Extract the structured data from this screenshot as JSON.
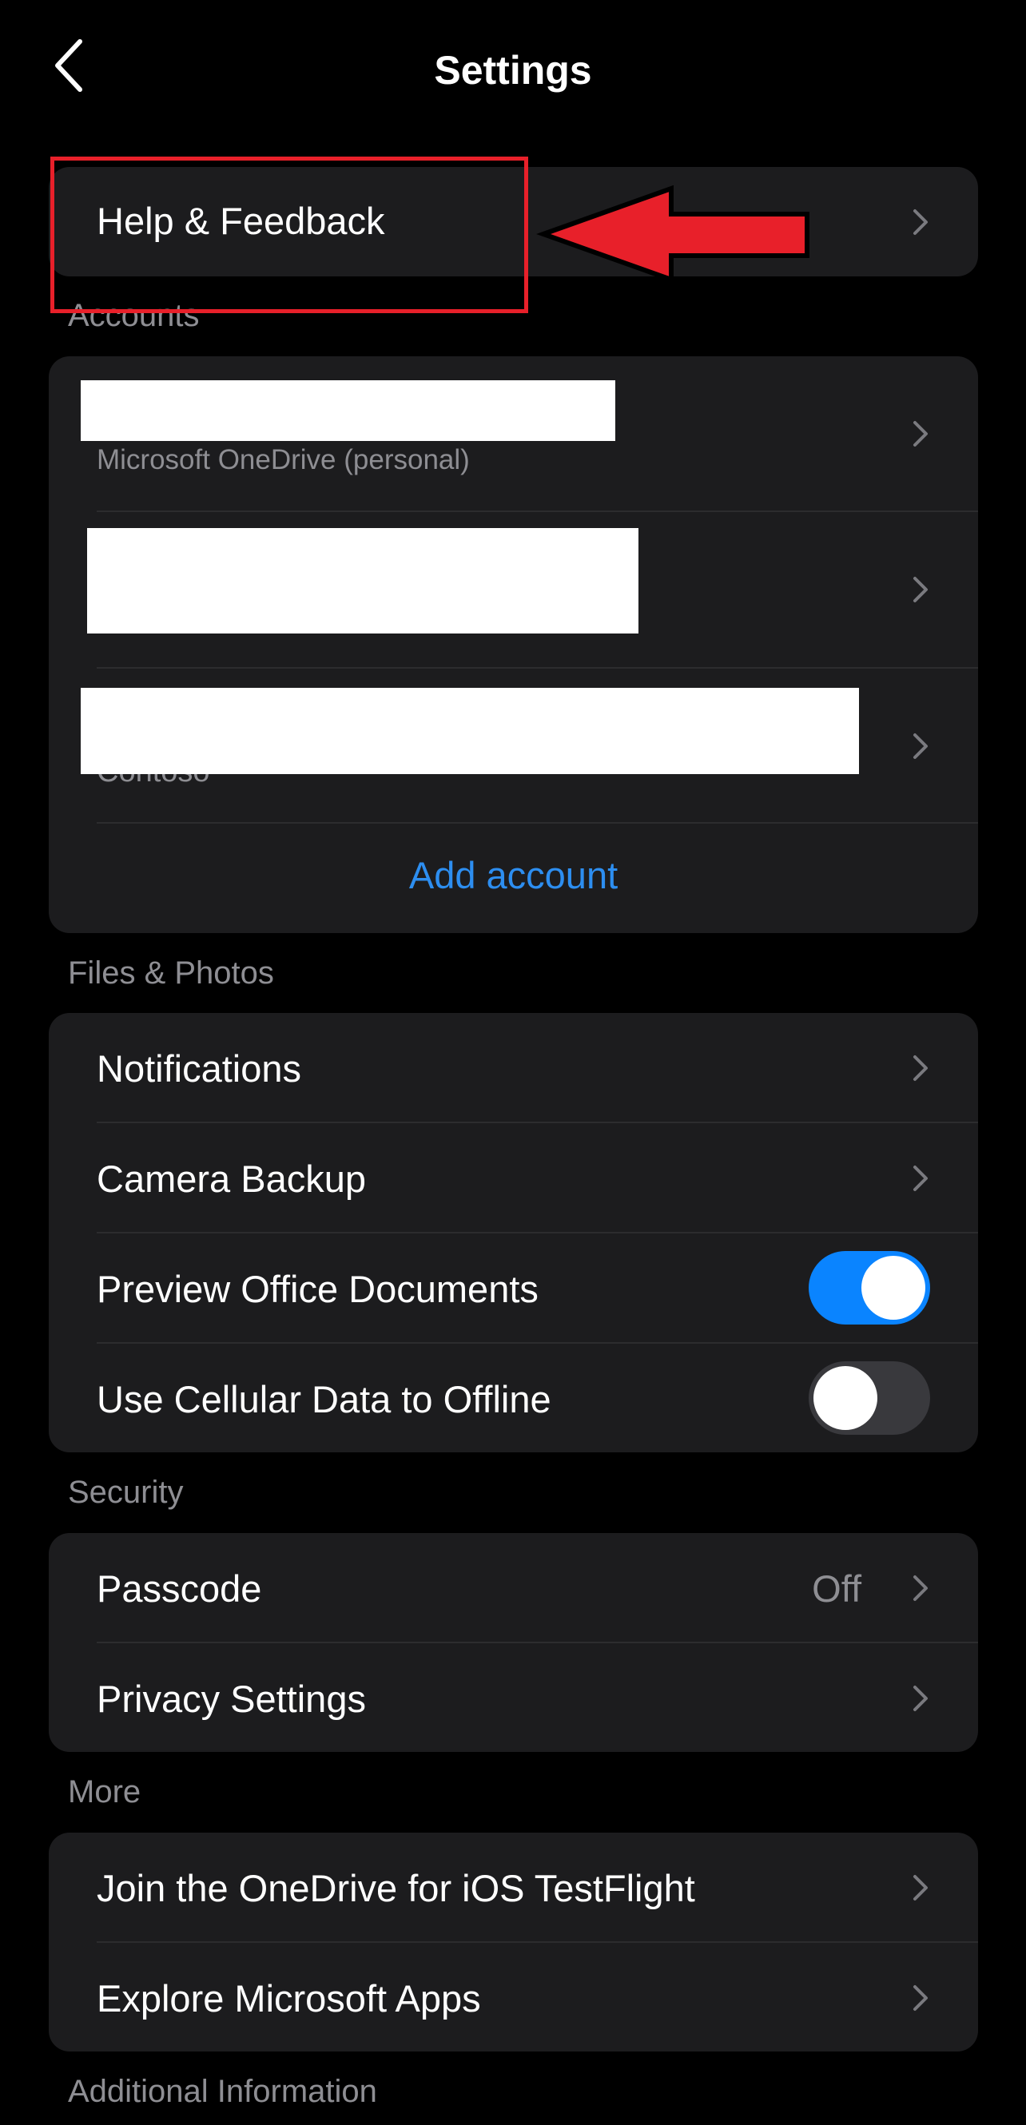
{
  "header": {
    "title": "Settings",
    "back_icon": "chevron-left-icon"
  },
  "help": {
    "label": "Help & Feedback"
  },
  "accounts": {
    "section_label": "Accounts",
    "items": [
      {
        "subtitle": "Microsoft OneDrive (personal)"
      },
      {
        "subtitle": ""
      },
      {
        "subtitle": "Contoso"
      }
    ],
    "add_label": "Add account"
  },
  "files_photos": {
    "section_label": "Files & Photos",
    "notifications": "Notifications",
    "camera_backup": "Camera Backup",
    "preview_office": "Preview Office Documents",
    "preview_office_on": true,
    "cellular": "Use Cellular Data to Offline",
    "cellular_on": false
  },
  "security": {
    "section_label": "Security",
    "passcode": "Passcode",
    "passcode_value": "Off",
    "privacy": "Privacy Settings"
  },
  "more": {
    "section_label": "More",
    "testflight": "Join the OneDrive for iOS TestFlight",
    "explore": "Explore Microsoft Apps"
  },
  "additional": {
    "section_label": "Additional Information"
  },
  "colors": {
    "accent": "#2d8ef0",
    "annotation": "#e8202a",
    "toggle_on": "#0a84ff",
    "toggle_off": "#39393d"
  }
}
